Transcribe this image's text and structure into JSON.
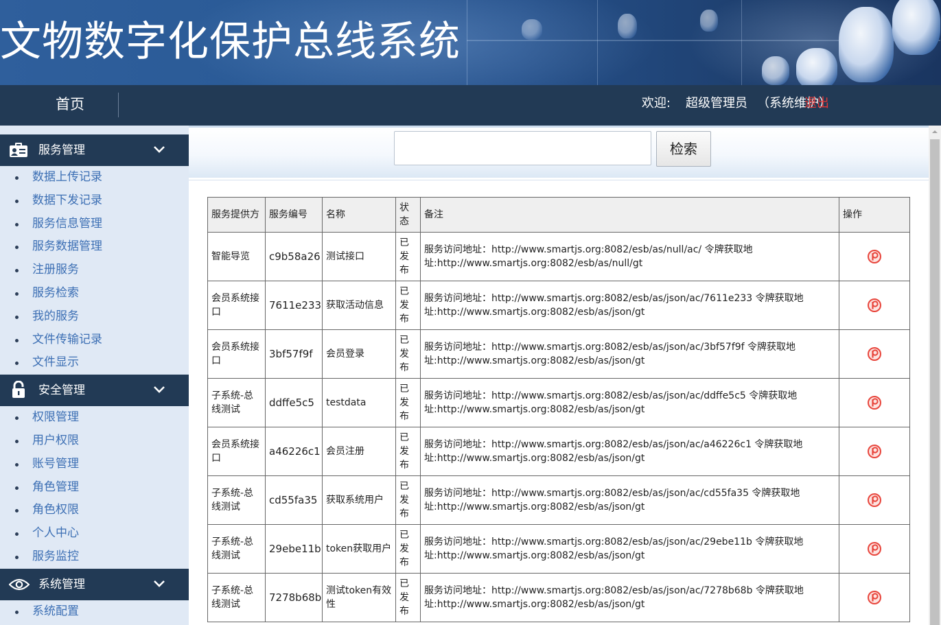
{
  "app": {
    "title": "文物数字化保护总线系统"
  },
  "nav": {
    "home": "首页",
    "welcome": "欢迎:",
    "user": "超级管理员",
    "role": "（系统维护）",
    "logout": "退出"
  },
  "sidebar": {
    "groups": [
      {
        "label": "服务管理",
        "icon": "id-card-icon",
        "items": [
          "数据上传记录",
          "数据下发记录",
          "服务信息管理",
          "服务数据管理",
          "注册服务",
          "服务检索",
          "我的服务",
          "文件传输记录",
          "文件显示"
        ]
      },
      {
        "label": "安全管理",
        "icon": "lock-icon",
        "items": [
          "权限管理",
          "用户权限",
          "账号管理",
          "角色管理",
          "角色权限",
          "个人中心",
          "服务监控"
        ]
      },
      {
        "label": "系统管理",
        "icon": "eye-icon",
        "items": [
          "系统配置"
        ]
      }
    ]
  },
  "search": {
    "value": "",
    "placeholder": "",
    "button": "检索"
  },
  "table": {
    "headers": [
      "服务提供方",
      "服务编号",
      "名称",
      "状态",
      "备注",
      "操作"
    ],
    "rows": [
      {
        "provider": "智能导览",
        "code": "c9b58a26",
        "name": "测试接口",
        "status": "已发布",
        "note": "服务访问地址：http://www.smartjs.org:8082/esb/as/null/ac/ 令牌获取地址:http://www.smartjs.org:8082/esb/as/null/gt"
      },
      {
        "provider": "会员系统接口",
        "code": "7611e233",
        "name": "获取活动信息",
        "status": "已发布",
        "note": "服务访问地址：http://www.smartjs.org:8082/esb/as/json/ac/7611e233 令牌获取地址:http://www.smartjs.org:8082/esb/as/json/gt"
      },
      {
        "provider": "会员系统接口",
        "code": "3bf57f9f",
        "name": "会员登录",
        "status": "已发布",
        "note": "服务访问地址：http://www.smartjs.org:8082/esb/as/json/ac/3bf57f9f 令牌获取地址:http://www.smartjs.org:8082/esb/as/json/gt"
      },
      {
        "provider": "子系统-总线测试",
        "code": "ddffe5c5",
        "name": "testdata",
        "status": "已发布",
        "note": "服务访问地址：http://www.smartjs.org:8082/esb/as/json/ac/ddffe5c5 令牌获取地址:http://www.smartjs.org:8082/esb/as/json/gt"
      },
      {
        "provider": "会员系统接口",
        "code": "a46226c1",
        "name": "会员注册",
        "status": "已发布",
        "note": "服务访问地址：http://www.smartjs.org:8082/esb/as/json/ac/a46226c1 令牌获取地址:http://www.smartjs.org:8082/esb/as/json/gt"
      },
      {
        "provider": "子系统-总线测试",
        "code": "cd55fa35",
        "name": "获取系统用户",
        "status": "已发布",
        "note": "服务访问地址：http://www.smartjs.org:8082/esb/as/json/ac/cd55fa35 令牌获取地址:http://www.smartjs.org:8082/esb/as/json/gt"
      },
      {
        "provider": "子系统-总线测试",
        "code": "29ebe11b",
        "name": "token获取用户",
        "status": "已发布",
        "note": "服务访问地址：http://www.smartjs.org:8082/esb/as/json/ac/29ebe11b 令牌获取地址:http://www.smartjs.org:8082/esb/as/json/gt"
      },
      {
        "provider": "子系统-总线测试",
        "code": "7278b68b",
        "name": "测试token有效性",
        "status": "已发布",
        "note": "服务访问地址：http://www.smartjs.org:8082/esb/as/json/ac/7278b68b 令牌获取地址:http://www.smartjs.org:8082/esb/as/json/gt"
      }
    ],
    "action_icon": "view-detail-icon"
  },
  "colors": {
    "navbar": "#223a55",
    "sidebar_bg": "#e0e9f5",
    "link": "#3c6fb4",
    "logout": "#e33636",
    "action_icon": "#e8453c"
  }
}
